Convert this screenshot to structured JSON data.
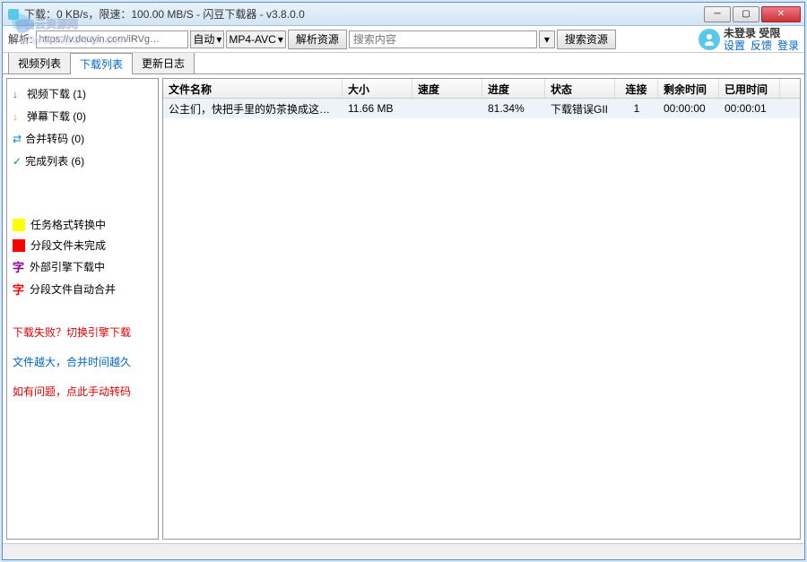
{
  "window": {
    "title": "下载：0 KB/s，限速：100.00 MB/S - 闪豆下载器 - v3.8.0.0"
  },
  "toolbar": {
    "parse_label": "解析:",
    "url_value": "https://v.douyin.com/iRVg…",
    "auto_label": "自动",
    "format_label": "MP4-AVC",
    "parse_btn": "解析资源",
    "search_placeholder": "搜索内容",
    "search_btn": "搜索资源"
  },
  "user": {
    "status_label": "未登录",
    "limit_label": "受限",
    "links": [
      "设置",
      "反馈",
      "登录"
    ]
  },
  "tabs": [
    "视频列表",
    "下载列表",
    "更新日志"
  ],
  "sidebar": {
    "items": [
      {
        "label": "视频下载 (1)",
        "icon": "down-blue"
      },
      {
        "label": "弹幕下载 (0)",
        "icon": "down-orange"
      },
      {
        "label": "合并转码 (0)",
        "icon": "swap"
      },
      {
        "label": "完成列表 (6)",
        "icon": "check"
      }
    ],
    "legends": [
      {
        "swatch": "yellow",
        "label": "任务格式转换中"
      },
      {
        "swatch": "red",
        "label": "分段文件未完成"
      },
      {
        "char": "字",
        "color": "#808",
        "label": "外部引擎下载中"
      },
      {
        "char": "字",
        "color": "#f00",
        "label": "分段文件自动合并"
      }
    ],
    "tips": [
      {
        "cls": "red",
        "label": "下载失败？切换引擎下载"
      },
      {
        "cls": "blue",
        "label": "文件越大，合并时间越久"
      },
      {
        "cls": "red",
        "label": "如有问题，点此手动转码"
      }
    ]
  },
  "table": {
    "headers": {
      "name": "文件名称",
      "size": "大小",
      "speed": "速度",
      "progress": "进度",
      "status": "状态",
      "conn": "连接",
      "remain": "剩余时间",
      "used": "已用时间"
    },
    "rows": [
      {
        "name": "公主们，快把手里的奶茶换成这个小…",
        "size": "11.66 MB",
        "speed": "",
        "progress": "81.34%",
        "status": "下载错误GII",
        "conn": "1",
        "remain": "00:00:00",
        "used": "00:00:01"
      }
    ]
  },
  "watermark": {
    "line1": "白云资源网",
    "line2": "WWW.52BYW.CN"
  }
}
